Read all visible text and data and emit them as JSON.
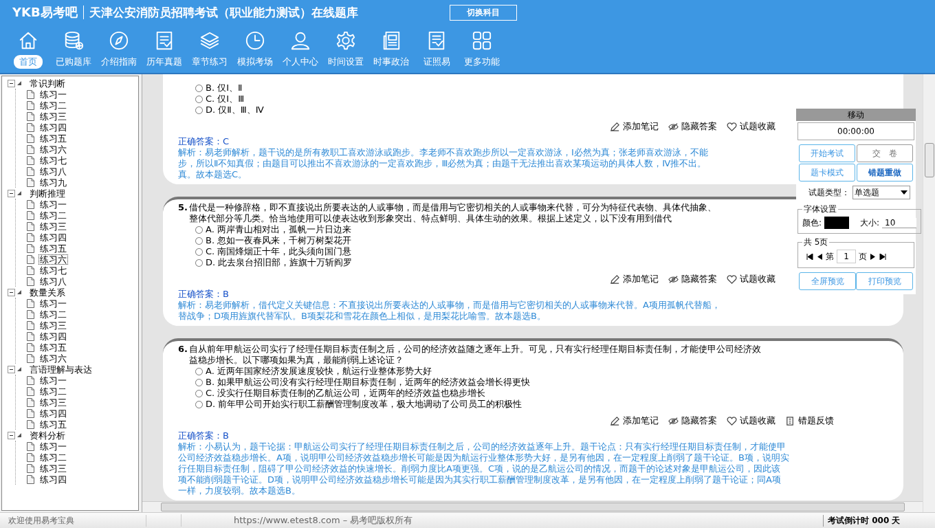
{
  "header": {
    "logo": "YKB易考吧",
    "title": "天津公安消防员招聘考试（职业能力测试）在线题库",
    "switch_button": "切换科目"
  },
  "nav": [
    {
      "label": "首页",
      "selected": true
    },
    {
      "label": "已购题库",
      "selected": false
    },
    {
      "label": "介绍指南",
      "selected": false
    },
    {
      "label": "历年真题",
      "selected": false
    },
    {
      "label": "章节练习",
      "selected": false
    },
    {
      "label": "模拟考场",
      "selected": false
    },
    {
      "label": "个人中心",
      "selected": false
    },
    {
      "label": "时间设置",
      "selected": false
    },
    {
      "label": "时事政治",
      "selected": false
    },
    {
      "label": "证照易",
      "selected": false
    },
    {
      "label": "更多功能",
      "selected": false
    }
  ],
  "tree": [
    {
      "label": "常识判断",
      "expanded": true,
      "children": [
        {
          "label": "练习一",
          "selected": false
        },
        {
          "label": "练习二",
          "selected": false
        },
        {
          "label": "练习三",
          "selected": false
        },
        {
          "label": "练习四",
          "selected": false
        },
        {
          "label": "练习五",
          "selected": false
        },
        {
          "label": "练习六",
          "selected": false
        },
        {
          "label": "练习七",
          "selected": false
        },
        {
          "label": "练习八",
          "selected": false
        },
        {
          "label": "练习九",
          "selected": false
        }
      ]
    },
    {
      "label": "判断推理",
      "expanded": true,
      "children": [
        {
          "label": "练习一",
          "selected": false
        },
        {
          "label": "练习二",
          "selected": false
        },
        {
          "label": "练习三",
          "selected": false
        },
        {
          "label": "练习四",
          "selected": false
        },
        {
          "label": "练习五",
          "selected": false
        },
        {
          "label": "练习六",
          "selected": true
        },
        {
          "label": "练习七",
          "selected": false
        },
        {
          "label": "练习八",
          "selected": false
        }
      ]
    },
    {
      "label": "数量关系",
      "expanded": true,
      "children": [
        {
          "label": "练习一",
          "selected": false
        },
        {
          "label": "练习二",
          "selected": false
        },
        {
          "label": "练习三",
          "selected": false
        },
        {
          "label": "练习四",
          "selected": false
        },
        {
          "label": "练习五",
          "selected": false
        },
        {
          "label": "练习六",
          "selected": false
        }
      ]
    },
    {
      "label": "言语理解与表达",
      "expanded": true,
      "children": [
        {
          "label": "练习一",
          "selected": false
        },
        {
          "label": "练习二",
          "selected": false
        },
        {
          "label": "练习三",
          "selected": false
        },
        {
          "label": "练习四",
          "selected": false
        },
        {
          "label": "练习五",
          "selected": false
        }
      ]
    },
    {
      "label": "资料分析",
      "expanded": true,
      "children": [
        {
          "label": "练习一",
          "selected": false
        },
        {
          "label": "练习二",
          "selected": false
        },
        {
          "label": "练习三",
          "selected": false
        },
        {
          "label": "练习四",
          "selected": false
        }
      ]
    }
  ],
  "questions": [
    {
      "options": [
        {
          "label": "B. 仅Ⅰ、Ⅱ",
          "selected": false
        },
        {
          "label": "C. 仅Ⅰ、Ⅲ",
          "selected": false
        },
        {
          "label": "D. 仅Ⅱ、Ⅲ、Ⅳ",
          "selected": false
        }
      ],
      "actions": [
        "添加笔记",
        "隐藏答案",
        "试题收藏"
      ],
      "answer": "正确答案：C",
      "explanation_lines": [
        "解析：易老师解析，题干说的是所有教职工喜欢游泳或跑步。李老师不喜欢跑步所以一定喜欢游泳，Ⅰ必然为真；张老师喜欢游泳，不能",
        "步，所以Ⅱ不知真假；由题目可以推出不喜欢游泳的一定喜欢跑步，Ⅲ必然为真；由题干无法推出喜欢某项运动的具体人数，Ⅳ推不出。",
        "真。故本题选C。"
      ]
    },
    {
      "number": "5.",
      "stem_lines": [
        "借代是一种修辞格，即不直接说出所要表达的人或事物，而是借用与它密切相关的人或事物来代替，可分为特征代表物、具体代抽象、",
        "整体代部分等几类。恰当地使用可以使表达收到形象突出、特点鲜明、具体生动的效果。根据上述定义，以下没有用到借代"
      ],
      "options": [
        {
          "label": "A. 两岸青山相对出，孤帆一片日边来",
          "selected": false
        },
        {
          "label": "B. 忽如一夜春风来，千树万树梨花开",
          "selected": false
        },
        {
          "label": "C. 南国烽烟正十年，此头须向国门悬",
          "selected": false
        },
        {
          "label": "D. 此去泉台招旧部，旌旗十万斩阎罗",
          "selected": false
        }
      ],
      "actions": [
        "添加笔记",
        "隐藏答案",
        "试题收藏"
      ],
      "answer": "正确答案：B",
      "explanation_lines": [
        "解析：易老师解析，借代定义关键信息：不直接说出所要表达的人或事物，而是借用与它密切相关的人或事物来代替。A项用孤帆代替船，",
        "替战争；D项用旌旗代替军队。B项梨花和雪花在颜色上相似，是用梨花比喻雪。故本题选B。"
      ]
    },
    {
      "number": "6.",
      "stem_lines": [
        "自从前年甲航运公司实行了经理任期目标责任制之后，公司的经济效益随之逐年上升。可见，只有实行经理任期目标责任制，才能使甲公司经济效",
        "益稳步增长。以下哪项如果为真，最能削弱上述论证？"
      ],
      "options": [
        {
          "label": "A. 近两年国家经济发展速度较快，航运行业整体形势大好",
          "selected": false
        },
        {
          "label": "B. 如果甲航运公司没有实行经理任期目标责任制，近两年的经济效益会增长得更快",
          "selected": false
        },
        {
          "label": "C. 没实行任期目标责任制的乙航运公司，近两年的经济效益也稳步增长",
          "selected": false
        },
        {
          "label": "D. 前年甲公司开始实行职工薪酬管理制度改革，极大地调动了公司员工的积极性",
          "selected": false
        }
      ],
      "actions": [
        "添加笔记",
        "隐藏答案",
        "试题收藏",
        "错题反馈"
      ],
      "answer": "正确答案：B",
      "explanation_lines": [
        "解析：小易认为，题干论据：甲航运公司实行了经理任期目标责任制之后，公司的经济效益逐年上升。题干论点：只有实行经理任期目标责任制，才能使甲",
        "公司经济效益稳步增长。A项，说明甲公司经济效益稳步增长可能是因为航运行业整体形势大好，是另有他因，在一定程度上削弱了题干论证。B项，说明实",
        "行任期目标责任制，阻碍了甲公司经济效益的快速增长。削弱力度比A项更强。C项，说的是乙航运公司的情况，而题干的论述对象是甲航运公司，因此该",
        "项不能削弱题干论证。D项，说明甲公司经济效益稳步增长可能是因为其实行职工薪酬管理制度改革，是另有他因，在一定程度上削弱了题干论证；同A项",
        "一样，力度较弱。故本题选B。"
      ]
    }
  ],
  "panel": {
    "title": "移动",
    "timer": "00:00:00",
    "buttons": [
      {
        "label": "开始考试",
        "selected": false
      },
      {
        "label": "交　卷",
        "selected": false
      },
      {
        "label": "题卡模式",
        "selected": false
      },
      {
        "label": "错题重做",
        "selected": true
      }
    ],
    "type_label": "试题类型：",
    "type_value": "单选题",
    "font_legend": "字体设置",
    "color_label": "颜色:",
    "color": "#000000",
    "size_label": "大小:",
    "size_value": "10",
    "pages_legend": "共 5页",
    "page_prefix": "第",
    "page_value": "1",
    "page_suffix": "页",
    "bottom_buttons": [
      "全屏预览",
      "打印预览"
    ]
  },
  "status_bar": {
    "welcome": "欢迎使用易考宝典",
    "copyright": "https://www.etest8.com – 易考吧版权所有",
    "countdown": "考试倒计时 000 天"
  }
}
